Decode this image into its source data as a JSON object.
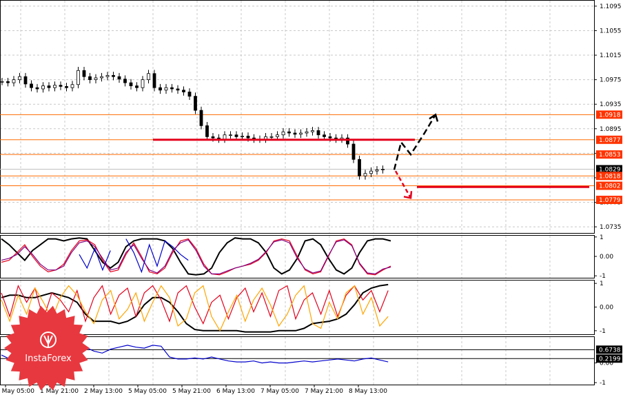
{
  "chart_data": [
    {
      "type": "candlestick",
      "y_ticks": [
        "1.1095",
        "1.1055",
        "1.1015",
        "1.0975",
        "1.0935",
        "1.0895",
        "1.0855",
        "1.0815",
        "1.0775",
        "1.0735"
      ],
      "ylim": [
        1.0725,
        1.1105
      ],
      "x_ticks": [
        "1 May 05:00",
        "1 May 21:00",
        "2 May 13:00",
        "5 May 05:00",
        "5 May 21:00",
        "6 May 13:00",
        "7 May 05:00",
        "7 May 21:00",
        "8 May 13:00"
      ],
      "grid": true,
      "close_series": [
        1.0972,
        1.097,
        1.0975,
        1.098,
        1.0968,
        1.0962,
        1.096,
        1.0965,
        1.0962,
        1.0966,
        1.0964,
        1.0962,
        1.0967,
        1.099,
        1.098,
        1.0975,
        1.0978,
        1.098,
        1.0982,
        1.098,
        1.0976,
        1.097,
        1.0965,
        1.0962,
        1.0975,
        1.0985,
        1.0962,
        1.0958,
        1.0962,
        1.096,
        1.0958,
        1.0955,
        1.0948,
        1.0925,
        1.09,
        1.0882,
        1.088,
        1.0878,
        1.0885,
        1.0885,
        1.0882,
        1.0883,
        1.088,
        1.0878,
        1.0878,
        1.0882,
        1.0882,
        1.0885,
        1.089,
        1.0888,
        1.0886,
        1.0888,
        1.089,
        1.0892,
        1.0885,
        1.0882,
        1.088,
        1.0878,
        1.088,
        1.087,
        1.0845,
        1.0818,
        1.0822,
        1.0826,
        1.0828,
        1.0829
      ],
      "price_tags": [
        {
          "value": 1.0918,
          "label": "1.0918",
          "color": "#ff3300"
        },
        {
          "value": 1.0877,
          "label": "1.0877",
          "color": "#ff3300"
        },
        {
          "value": 1.0853,
          "label": "1.0853",
          "color": "#ff3300"
        },
        {
          "value": 1.0829,
          "label": "1.0829",
          "color": "#000000"
        },
        {
          "value": 1.0818,
          "label": "1.0818",
          "color": "#ff3300"
        },
        {
          "value": 1.0802,
          "label": "1.0802",
          "color": "#ff3300"
        },
        {
          "value": 1.0779,
          "label": "1.0779",
          "color": "#ff3300"
        }
      ],
      "horizontal_lines": [
        1.0918,
        1.0877,
        1.0853,
        1.0818,
        1.0802,
        1.0779
      ],
      "thick_levels": [
        {
          "value": 1.0877,
          "from_x_index": 28,
          "to_x_index": 75,
          "color": "#e3001b"
        },
        {
          "value": 1.08,
          "from_x_index": 77,
          "to_x_index": 108,
          "color": "#e3001b"
        }
      ],
      "forecast_arrows": [
        {
          "direction": "up",
          "color": "#000000",
          "points": [
            [
              1.0828,
              0
            ],
            [
              1.0873,
              1
            ],
            [
              1.0853,
              2
            ],
            [
              1.0888,
              3
            ],
            [
              1.0918,
              4
            ]
          ]
        },
        {
          "direction": "down",
          "color": "#e3001b",
          "points": [
            [
              1.0826,
              0
            ],
            [
              1.0782,
              1
            ]
          ]
        }
      ]
    },
    {
      "type": "line",
      "y_ticks": [
        "1",
        "0.00",
        "-1"
      ],
      "ylim": [
        -1.1,
        1.1
      ],
      "series": [
        {
          "color": "#000000",
          "values": [
            0.9,
            0.6,
            0.2,
            -0.2,
            0.3,
            0.6,
            0.9,
            0.9,
            0.8,
            0.9,
            0.95,
            0.9,
            0.3,
            -0.3,
            -0.6,
            -0.3,
            0.5,
            0.8,
            0.9,
            0.9,
            0.9,
            0.8,
            0.4,
            -0.3,
            -0.9,
            -0.95,
            -0.9,
            -0.6,
            0.2,
            0.7,
            0.95,
            0.9,
            0.9,
            0.7,
            0.2,
            -0.6,
            -0.9,
            -0.7,
            -0.1,
            0.8,
            0.9,
            0.6,
            -0.1,
            -0.7,
            -0.9,
            -0.6,
            0.2,
            0.8,
            0.9,
            0.9,
            0.8
          ]
        },
        {
          "color": "#e3001b",
          "values": [
            -0.3,
            -0.2,
            0.2,
            0.6,
            0.0,
            -0.5,
            -0.8,
            -0.7,
            -0.4,
            0.3,
            0.8,
            0.85,
            0.6,
            -0.2,
            -0.8,
            -0.7,
            0.1,
            0.7,
            0.0,
            -0.8,
            -0.9,
            -0.6,
            0.2,
            0.8,
            0.9,
            0.4,
            -0.4,
            -0.9,
            -0.95,
            -0.8,
            -0.6,
            -0.5,
            -0.4,
            -0.2,
            0.2,
            0.8,
            0.9,
            0.8,
            0.0,
            -0.7,
            -0.9,
            -0.8,
            0.0,
            0.8,
            0.9,
            0.6,
            -0.4,
            -0.9,
            -0.95,
            -0.7,
            -0.5
          ]
        },
        {
          "color": "#800080",
          "values": [
            -0.2,
            -0.1,
            0.1,
            0.5,
            0.1,
            -0.4,
            -0.7,
            -0.7,
            -0.5,
            0.2,
            0.7,
            0.8,
            0.5,
            -0.1,
            -0.7,
            -0.6,
            0.2,
            0.6,
            -0.1,
            -0.7,
            -0.85,
            -0.5,
            0.3,
            0.7,
            0.85,
            0.3,
            -0.5,
            -0.9,
            -0.9,
            -0.75,
            -0.6,
            -0.5,
            -0.35,
            -0.15,
            0.25,
            0.75,
            0.85,
            0.7,
            -0.1,
            -0.65,
            -0.85,
            -0.75,
            0.05,
            0.75,
            0.85,
            0.55,
            -0.35,
            -0.85,
            -0.9,
            -0.65,
            -0.55
          ]
        },
        {
          "color": "#0000cc",
          "values": [
            null,
            null,
            null,
            null,
            null,
            null,
            null,
            null,
            null,
            null,
            0.1,
            -0.6,
            0.4,
            -0.7,
            0.3,
            null,
            0.9,
            0.2,
            -0.8,
            0.6,
            -0.5,
            0.8,
            0.5,
            0.1,
            -0.2,
            null,
            null,
            null,
            null,
            null,
            null,
            null,
            null,
            null,
            null,
            null,
            null,
            null,
            null,
            null,
            null,
            null,
            null,
            null,
            null,
            null,
            null,
            null,
            null,
            null,
            null
          ]
        }
      ]
    },
    {
      "type": "line",
      "y_ticks": [
        "1",
        "0.00",
        "-1"
      ],
      "ylim": [
        -1.15,
        1.15
      ],
      "series": [
        {
          "color": "#000000",
          "values": [
            0.4,
            0.5,
            0.5,
            0.4,
            0.4,
            0.5,
            0.6,
            0.5,
            0.4,
            0.2,
            -0.3,
            -0.6,
            -0.6,
            -0.6,
            -0.7,
            -0.6,
            -0.4,
            0.1,
            0.4,
            0.4,
            0.2,
            -0.2,
            -0.7,
            -0.95,
            -1.0,
            -1.0,
            -1.0,
            -1.0,
            -1.0,
            -1.05,
            -1.05,
            -1.05,
            -1.05,
            -1.0,
            -1.0,
            -1.0,
            -0.9,
            -0.7,
            -0.65,
            -0.6,
            -0.5,
            -0.3,
            0.1,
            0.6,
            0.8,
            0.9,
            0.95
          ]
        },
        {
          "color": "#e3001b",
          "values": [
            0.6,
            -0.4,
            0.9,
            0.2,
            0.8,
            -0.5,
            0.6,
            0.3,
            -0.2,
            0.7,
            -0.6,
            0.4,
            0.9,
            -0.3,
            0.5,
            0.8,
            -0.4,
            0.6,
            0.9,
            0.3,
            -0.6,
            0.6,
            0.9,
            0.0,
            -0.7,
            0.2,
            0.5,
            -0.5,
            0.4,
            0.8,
            -0.2,
            0.6,
            -0.4,
            0.7,
            0.9,
            -0.5,
            0.3,
            0.6,
            -0.3,
            0.7,
            -0.4,
            0.5,
            0.9,
            0.3,
            0.7,
            -0.2,
            0.7
          ]
        },
        {
          "color": "#ffa500",
          "values": [
            0.3,
            -0.6,
            0.5,
            -0.3,
            0.8,
            0.2,
            -0.5,
            0.4,
            0.9,
            0.5,
            -0.2,
            -0.7,
            0.3,
            0.7,
            -0.5,
            -0.1,
            0.6,
            -0.6,
            0.2,
            0.9,
            0.4,
            -0.8,
            -0.5,
            0.6,
            0.9,
            -0.4,
            -1.0,
            -0.2,
            0.5,
            -0.6,
            0.3,
            0.8,
            0.1,
            -0.8,
            -0.3,
            0.5,
            0.9,
            -0.7,
            -0.9,
            0.2,
            -0.5,
            0.6,
            0.9,
            -0.3,
            0.4,
            -0.8,
            -0.4
          ]
        }
      ]
    },
    {
      "type": "line",
      "y_ticks": [
        "0.00",
        "-1"
      ],
      "ylim": [
        -1.1,
        1.35
      ],
      "price_tags": [
        {
          "value": 0.6738,
          "label": "0.6738",
          "color": "#000000"
        },
        {
          "value": 0.2199,
          "label": "0.2199",
          "color": "#000000"
        }
      ],
      "horizontal_lines": [
        0.6738,
        0.2199
      ],
      "series": [
        {
          "color": "#0000cc",
          "values": [
            0.4,
            0.2,
            0.4,
            0.5,
            0.3,
            0.6,
            0.8,
            0.7,
            0.85,
            0.9,
            0.8,
            0.6,
            0.5,
            0.7,
            0.8,
            0.9,
            0.8,
            0.75,
            0.9,
            0.85,
            0.3,
            0.2,
            0.2,
            0.25,
            0.2,
            0.3,
            0.2,
            0.1,
            0.05,
            0.05,
            0.1,
            0.0,
            0.05,
            0.0,
            0.0,
            0.05,
            0.1,
            0.05,
            0.1,
            0.15,
            0.2,
            0.15,
            0.1,
            0.2,
            0.25,
            0.15,
            0.05
          ]
        }
      ]
    }
  ],
  "logo": {
    "text": "InstaForex"
  }
}
